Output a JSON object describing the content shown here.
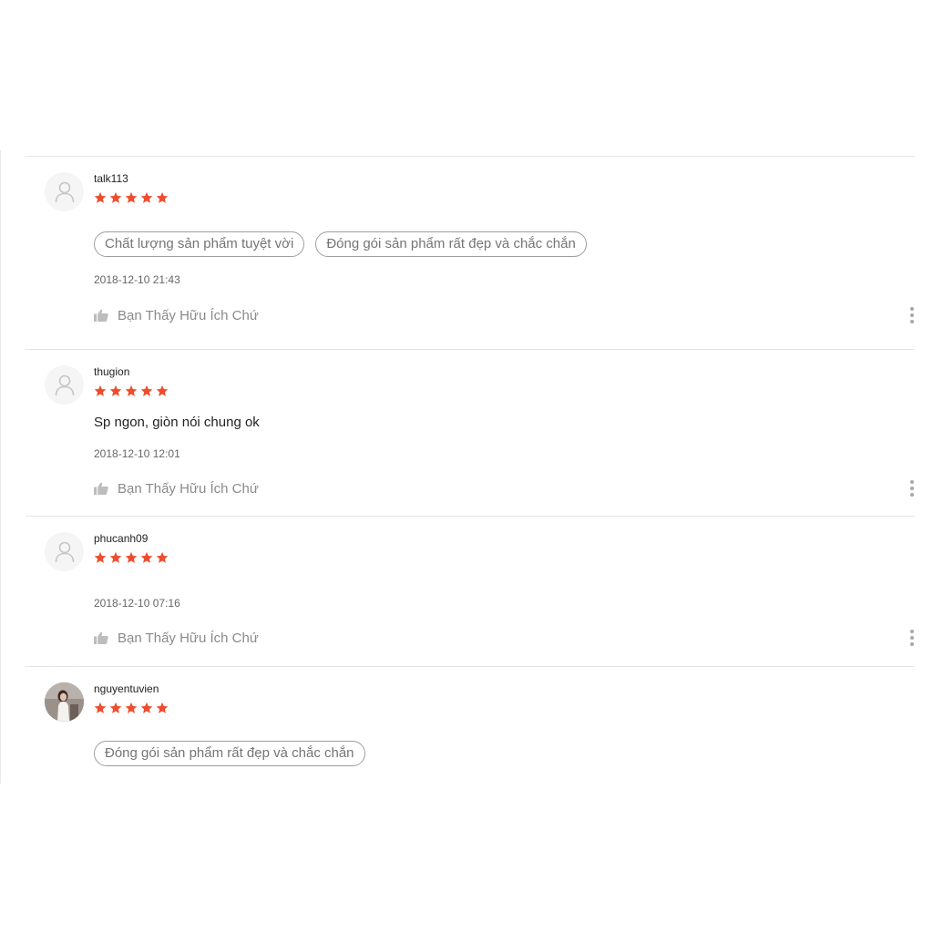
{
  "theme": {
    "star_color": "#ee4d2d",
    "tag_border": "#9e9e9e",
    "muted_text": "#8a8a8a"
  },
  "reviews": [
    {
      "username": "talk113",
      "rating": 5,
      "avatar": "default-user-icon",
      "tags": [
        "Chất lượng sản phẩm tuyệt vời",
        "Đóng gói sản phẩm rất đẹp và chắc chắn"
      ],
      "comment": "",
      "date": "2018-12-10 21:43",
      "helpful_label": "Bạn Thấy Hữu Ích Chứ"
    },
    {
      "username": "thugion",
      "rating": 5,
      "avatar": "default-user-icon",
      "tags": [],
      "comment": "Sp ngon, giòn nói chung ok",
      "date": "2018-12-10 12:01",
      "helpful_label": "Bạn Thấy Hữu Ích Chứ"
    },
    {
      "username": "phucanh09",
      "rating": 5,
      "avatar": "default-user-icon",
      "tags": [],
      "comment": "",
      "date": "2018-12-10 07:16",
      "helpful_label": "Bạn Thấy Hữu Ích Chứ"
    },
    {
      "username": "nguyentuvien",
      "rating": 5,
      "avatar": "user-photo",
      "tags": [
        "Đóng gói sản phẩm rất đẹp và chắc chắn"
      ],
      "comment": "",
      "date": "",
      "helpful_label": ""
    }
  ]
}
